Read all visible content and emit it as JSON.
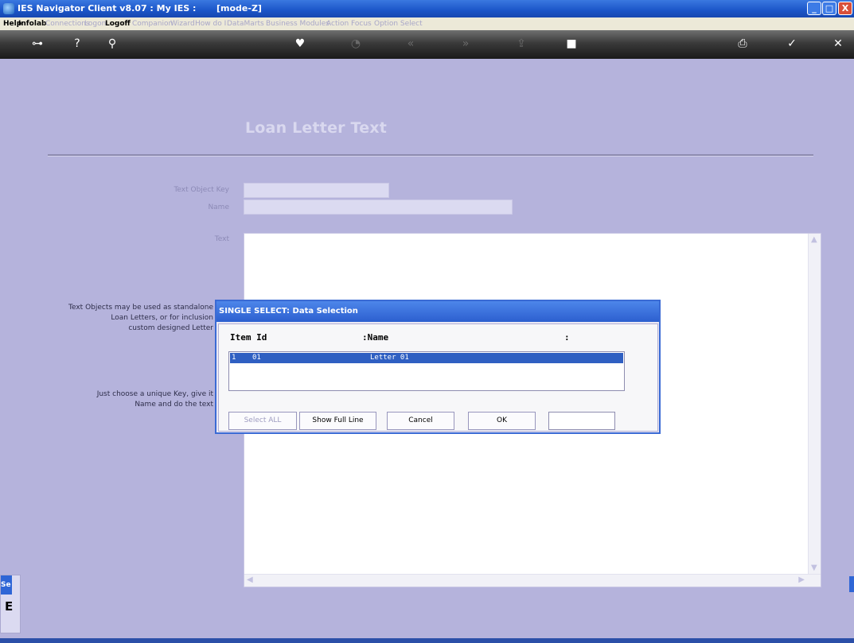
{
  "window": {
    "title": "IES Navigator Client v8.07 : My IES :",
    "mode": "[mode-Z]",
    "buttons": {
      "minimize": "_",
      "maximize": "□",
      "close": "X"
    }
  },
  "menu": [
    {
      "label": "Help",
      "enabled": true
    },
    {
      "label": "Infolab",
      "enabled": true
    },
    {
      "label": "Connections",
      "enabled": false
    },
    {
      "label": "Logon",
      "enabled": false
    },
    {
      "label": "Logoff",
      "enabled": true
    },
    {
      "label": "Companion",
      "enabled": false
    },
    {
      "label": "Wizard",
      "enabled": false
    },
    {
      "label": "How do I",
      "enabled": false
    },
    {
      "label": "DataMarts",
      "enabled": false
    },
    {
      "label": "Business Modules",
      "enabled": false
    },
    {
      "label": "Action Focus",
      "enabled": false
    },
    {
      "label": "Option Select",
      "enabled": false
    }
  ],
  "toolbar": {
    "icons": [
      {
        "name": "key-icon",
        "glyph": "⊶"
      },
      {
        "name": "help-icon",
        "glyph": "?"
      },
      {
        "name": "search-icon",
        "glyph": "⚲"
      },
      {
        "name": "heart-icon",
        "glyph": "♥"
      },
      {
        "name": "clock-icon",
        "glyph": "◔"
      },
      {
        "name": "rewind-icon",
        "glyph": "«"
      },
      {
        "name": "forward-icon",
        "glyph": "»"
      },
      {
        "name": "export-icon",
        "glyph": "⇪"
      },
      {
        "name": "stop-icon",
        "glyph": "■"
      },
      {
        "name": "print-icon",
        "glyph": "⎙"
      },
      {
        "name": "check-icon",
        "glyph": "✓"
      },
      {
        "name": "cancel-icon",
        "glyph": "✕"
      }
    ]
  },
  "form": {
    "heading": "Loan Letter Text",
    "key_label": "Text Object Key",
    "name_label": "Name",
    "text_label": "Text",
    "key_value": "",
    "name_value": "",
    "help1": [
      "Text Objects may be used as standalone",
      "Loan Letters, or for inclusion",
      "custom designed Letter"
    ],
    "help2": [
      "Just choose a unique Key, give it",
      "Name and do the text"
    ]
  },
  "dialog": {
    "title": "SINGLE SELECT: Data Selection",
    "columns": [
      "Item Id",
      ":Name",
      ":"
    ],
    "rows": [
      {
        "num": "1",
        "id": "01",
        "name": "Letter 01",
        "selected": true
      }
    ],
    "buttons": {
      "select_all": "Select ALL",
      "show_full_line": "Show Full Line",
      "cancel": "Cancel",
      "ok": "OK"
    },
    "input_value": ""
  },
  "side_panel": {
    "tab_label": "Se",
    "glyph": "E"
  }
}
